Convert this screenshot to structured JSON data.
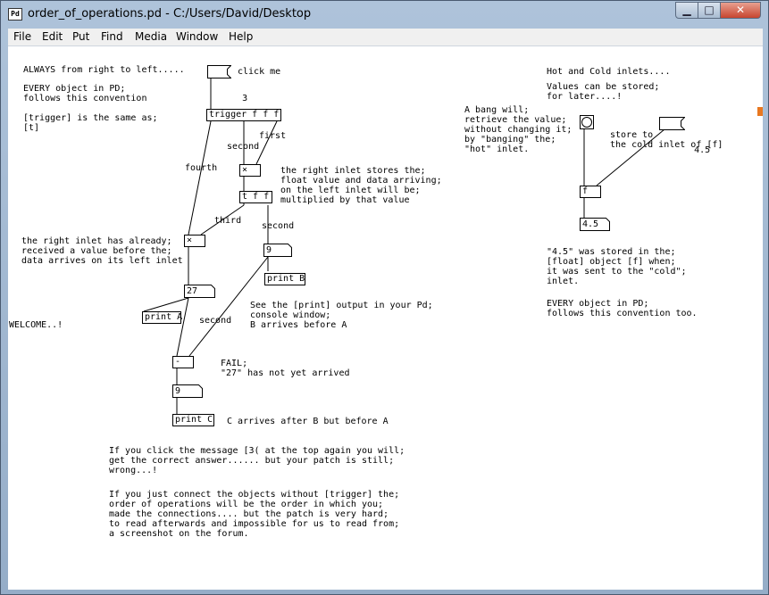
{
  "window": {
    "title": "order_of_operations.pd  - C:/Users/David/Desktop",
    "app_icon": "Pd",
    "controls": {
      "minimize": "▁",
      "maximize": "□",
      "close": "✕"
    }
  },
  "menu": [
    "File",
    "Edit",
    "Put",
    "Find",
    "Media",
    "Window",
    "Help"
  ],
  "comments": {
    "c1": "ALWAYS from right to left.....",
    "c2": "EVERY object in PD;\nfollows this convention",
    "c3": "[trigger] is the same as;\n[t]",
    "c4": "click me",
    "c5": "first",
    "c6": "second",
    "c7": "fourth",
    "c8": "the right inlet stores the;\nfloat value and data arriving;\non the left inlet will be;\nmultiplied by that value",
    "c9": "third",
    "c10": "second",
    "c11": "the right inlet has already;\nreceived a value before the;\ndata arrives on its left inlet",
    "c12": "See the [print] output in your Pd;\nconsole window;\nB arrives before A",
    "c13": "WELCOME..!",
    "c14": "second",
    "c15": "FAIL;\n\"27\" has not yet arrived",
    "c16": "C arrives after B but before A",
    "c17": "If you click the message [3( at the top again you will;\nget the correct answer...... but your patch is still;\nwrong...!",
    "c18": "If you just connect the objects without [trigger] the;\norder of operations will be the order in which you;\nmade the connections.... but the patch is very hard;\nto read afterwards and impossible for us to read from;\na screenshot on the forum.",
    "c19": "Hot and Cold inlets....",
    "c20": "Values can be stored;\nfor later....!",
    "c21": "A bang will;\nretrieve the value;\nwithout changing it;\nby \"banging\" the;\n\"hot\" inlet.",
    "c22": "store to\nthe cold inlet of [f]",
    "c23": "\"4.5\" was stored in the;\n[float] object [f] when;\nit was sent to the \"cold\";\ninlet.",
    "c24": "EVERY object in PD;\nfollows this convention too."
  },
  "objects": {
    "trigger": "trigger f f f",
    "mult1": "×",
    "tff": "t f f",
    "mult2": "×",
    "printA": "print A",
    "printB": "print B",
    "minus": "-",
    "printC": "print C",
    "f": "f"
  },
  "messages": {
    "msg3": "3",
    "msg45": "4.5"
  },
  "atoms": {
    "a27": "27",
    "a9b": "9",
    "a9c": "9",
    "a45": "4.5"
  }
}
